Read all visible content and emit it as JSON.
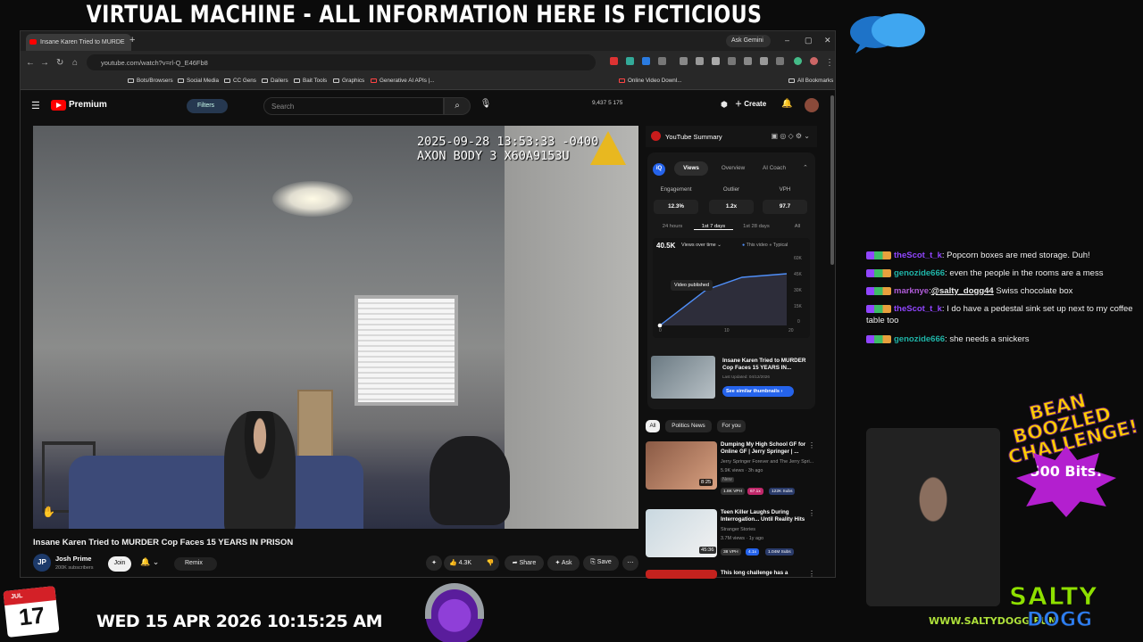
{
  "overlay": {
    "banner": "VIRTUAL MACHINE - ALL INFORMATION HERE IS FICTICIOUS",
    "date_text": "WED 15 APR 2026 10:15:25 AM",
    "calendar_month": "JUL",
    "calendar_day": "17",
    "site": "WWW.SALTYDOGG.FUN",
    "logo_top": "SALTY",
    "logo_bottom": "DOGG",
    "promo_top": "BEAN BOOZLED CHALLENGE!",
    "promo_bits": "500 Bits!"
  },
  "browser": {
    "tab_title": "Insane Karen Tried to MURDE",
    "new_tab_icon": "+",
    "gemini_label": "Ask Gemini",
    "url": "youtube.com/watch?v=rl-Q_E46Fb8",
    "bookmarks": [
      "Bots/Browsers",
      "Social Media",
      "CC Gens",
      "Dailers",
      "Bait Tools",
      "Graphics",
      "Generative AI APIs |...",
      "Online Video Downl...",
      "All Bookmarks"
    ]
  },
  "youtube": {
    "brand": "Premium",
    "filters_label": "Filters",
    "search_placeholder": "Search",
    "header_stats": "9,437   5   175",
    "create_label": "Create",
    "video": {
      "bodycam_line1": "2025-09-28 13:53:33 -0400",
      "bodycam_line2": "AXON BODY 3 X60A9153U",
      "title": "Insane Karen Tried to MURDER Cop Faces 15 YEARS IN PRISON",
      "channel": "Josh Prime",
      "channel_initials": "JP",
      "subscribers": "200K subscribers",
      "join": "Join",
      "remix": "Remix",
      "likes": "4.3K",
      "share": "Share",
      "ask": "Ask",
      "save": "Save"
    },
    "summary": {
      "title": "YouTube Summary",
      "tabs": [
        "Views",
        "Overview",
        "AI Coach"
      ],
      "metrics": [
        {
          "label": "Engagement",
          "value": "12.3%"
        },
        {
          "label": "Outlier",
          "value": "1.2x"
        },
        {
          "label": "VPH",
          "value": "97.7"
        }
      ],
      "ranges": [
        "24 hours",
        "1st 7 days",
        "1st 28 days",
        "All"
      ],
      "views_total": "40.5K",
      "chart_dropdown": "Views over time",
      "legend_this": "This video",
      "legend_typical": "Typical",
      "y_ticks": [
        "60K",
        "45K",
        "30K",
        "15K",
        "0"
      ],
      "x_ticks": [
        "0",
        "10",
        "20"
      ],
      "tooltip": "Video published",
      "thumb_title": "Insane Karen Tried to MURDER Cop Faces 15 YEARS IN...",
      "thumb_date": "Last Updated: 04/12/2026",
      "similar_btn": "See similar thumbnails"
    },
    "chips": [
      "All",
      "Politics News",
      "For you"
    ],
    "recommendations": [
      {
        "title": "Dumping My High School GF for Online GF | Jerry Springer | ...",
        "channel": "Jerry Springer Forever and The Jerry Spri...",
        "meta": "5.9K views · 3h ago",
        "extra": "New",
        "duration": "8:25",
        "badges": [
          "1.8K VPH",
          "67.1x",
          "122K Subs"
        ]
      },
      {
        "title": "Teen Killer Laughs During Interrogation... Until Reality Hits",
        "channel": "Stranger Stories",
        "meta": "3.7M views · 1y ago",
        "extra": "",
        "duration": "45:36",
        "badges": [
          "38 VPH",
          "4.1x",
          "1.04M Subs"
        ]
      },
      {
        "title": "This long challenge has a",
        "channel": "",
        "meta": "",
        "extra": "",
        "duration": "",
        "badges": []
      }
    ]
  },
  "chat": [
    {
      "user": "theScot_t_k",
      "color": "#9146ff",
      "text": "Popcorn boxes are med storage. Duh!"
    },
    {
      "user": "genozide666",
      "color": "#1fb5a8",
      "text": "even the people in the rooms are a mess"
    },
    {
      "user": "marknye",
      "color": "#b05cd8",
      "mention": "@salty_dogg44",
      "text": "Swiss chocolate box"
    },
    {
      "user": "theScot_t_k",
      "color": "#9146ff",
      "text": "I do have a pedestal sink set up next to my coffee table too"
    },
    {
      "user": "genozide666",
      "color": "#1fb5a8",
      "text": "she needs a snickers"
    }
  ]
}
